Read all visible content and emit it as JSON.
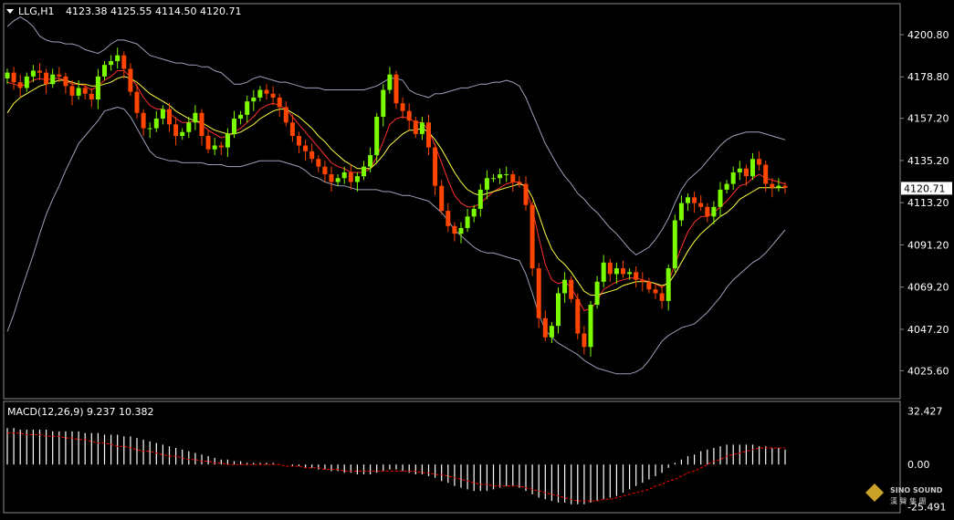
{
  "header": {
    "symbol": "LLG,H1",
    "ohlc": "4123.38 4125.55 4114.50 4120.71"
  },
  "macd_label": "MACD(12,26,9) 9.237 10.382",
  "watermark": {
    "line1": "SINO SOUND",
    "line2": "漢 聲 集 團"
  },
  "colors": {
    "background": "#000000",
    "grid_frame": "#8a8a8a",
    "bull": "#7cfc00",
    "bear": "#ff4500",
    "ma_fast": "#ff3030",
    "ma_slow": "#ffff40",
    "bands": "#9aa0b8",
    "text": "#ffffff",
    "macd_hist": "#ffffff",
    "macd_signal": "#ff0000"
  },
  "chart_data": [
    {
      "type": "candlestick",
      "title": "LLG,H1",
      "ylim": [
        4012,
        4216
      ],
      "y_ticks": [
        4200.8,
        4178.8,
        4157.2,
        4135.2,
        4113.2,
        4091.2,
        4069.2,
        4047.2,
        4025.6
      ],
      "y_tick_labels": [
        "4200.80",
        "4178.80",
        "4157.20",
        "4135.20",
        "4113.20",
        "4091.20",
        "4069.20",
        "4047.20",
        "4025.60"
      ],
      "current_price": 4120.71,
      "current_price_label": "4120.71",
      "closes": [
        4181,
        4176,
        4173,
        4179,
        4182,
        4181,
        4175,
        4180,
        4179,
        4174,
        4169,
        4173,
        4170,
        4167,
        4179,
        4185,
        4187,
        4190,
        4183,
        4171,
        4160,
        4152,
        4152,
        4157,
        4162,
        4154,
        4148,
        4150,
        4155,
        4160,
        4148,
        4141,
        4143,
        4142,
        4149,
        4157,
        4159,
        4166,
        4168,
        4172,
        4170,
        4168,
        4163,
        4155,
        4148,
        4143,
        4140,
        4136,
        4132,
        4128,
        4124,
        4126,
        4129,
        4124,
        4127,
        4132,
        4138,
        4158,
        4172,
        4180,
        4165,
        4161,
        4156,
        4149,
        4155,
        4142,
        4122,
        4109,
        4101,
        4097,
        4100,
        4106,
        4110,
        4120,
        4126,
        4126,
        4128,
        4128,
        4124,
        4123,
        4112,
        4079,
        4053,
        4043,
        4049,
        4066,
        4073,
        4063,
        4045,
        4038,
        4060,
        4072,
        4082,
        4076,
        4079,
        4076,
        4077,
        4073,
        4072,
        4068,
        4066,
        4062,
        4079,
        4104,
        4113,
        4116,
        4113,
        4111,
        4106,
        4111,
        4120,
        4123,
        4129,
        4131,
        4127,
        4136,
        4133,
        4123,
        4121,
        4122,
        4121
      ],
      "series": [
        {
          "name": "MA fast",
          "values": [
            4176,
            4175,
            4174,
            4175,
            4177,
            4178,
            4177,
            4178,
            4178,
            4177,
            4175,
            4175,
            4174,
            4172,
            4174,
            4177,
            4179,
            4182,
            4182,
            4179,
            4174,
            4168,
            4164,
            4162,
            4162,
            4160,
            4157,
            4155,
            4155,
            4156,
            4154,
            4151,
            4149,
            4147,
            4148,
            4150,
            4152,
            4155,
            4158,
            4162,
            4164,
            4165,
            4164,
            4162,
            4158,
            4154,
            4150,
            4146,
            4142,
            4138,
            4134,
            4132,
            4131,
            4129,
            4129,
            4129,
            4131,
            4137,
            4145,
            4154,
            4157,
            4158,
            4157,
            4155,
            4155,
            4151,
            4143,
            4134,
            4125,
            4117,
            4113,
            4111,
            4111,
            4113,
            4116,
            4119,
            4121,
            4123,
            4124,
            4124,
            4121,
            4110,
            4095,
            4081,
            4073,
            4071,
            4072,
            4069,
            4063,
            4057,
            4058,
            4062,
            4068,
            4070,
            4072,
            4073,
            4074,
            4074,
            4073,
            4072,
            4071,
            4069,
            4072,
            4081,
            4090,
            4098,
            4103,
            4106,
            4106,
            4108,
            4111,
            4114,
            4118,
            4122,
            4123,
            4126,
            4128,
            4126,
            4125,
            4124,
            4123
          ]
        },
        {
          "name": "MA slow",
          "values": [
            4160,
            4165,
            4168,
            4170,
            4172,
            4174,
            4175,
            4176,
            4177,
            4177,
            4176,
            4175,
            4175,
            4174,
            4174,
            4175,
            4176,
            4178,
            4179,
            4178,
            4176,
            4173,
            4170,
            4168,
            4166,
            4164,
            4161,
            4159,
            4157,
            4156,
            4155,
            4153,
            4151,
            4150,
            4149,
            4149,
            4150,
            4152,
            4154,
            4157,
            4159,
            4161,
            4162,
            4162,
            4160,
            4158,
            4155,
            4152,
            4148,
            4145,
            4141,
            4138,
            4135,
            4133,
            4131,
            4131,
            4131,
            4134,
            4138,
            4143,
            4146,
            4149,
            4151,
            4151,
            4152,
            4150,
            4146,
            4141,
            4135,
            4129,
            4124,
            4120,
            4118,
            4117,
            4118,
            4119,
            4120,
            4121,
            4122,
            4123,
            4122,
            4116,
            4107,
            4097,
            4089,
            4084,
            4081,
            4077,
            4072,
            4067,
            4065,
            4065,
            4066,
            4067,
            4068,
            4070,
            4071,
            4072,
            4072,
            4072,
            4071,
            4070,
            4071,
            4076,
            4082,
            4088,
            4093,
            4097,
            4100,
            4103,
            4106,
            4108,
            4111,
            4115,
            4117,
            4119,
            4121,
            4121,
            4121,
            4121,
            4121
          ]
        },
        {
          "name": "Upper band",
          "values": [
            4205,
            4208,
            4210,
            4208,
            4205,
            4200,
            4198,
            4197,
            4197,
            4196,
            4196,
            4195,
            4193,
            4192,
            4191,
            4193,
            4196,
            4198,
            4198,
            4197,
            4196,
            4193,
            4190,
            4189,
            4188,
            4187,
            4186,
            4186,
            4185,
            4185,
            4184,
            4184,
            4182,
            4181,
            4178,
            4175,
            4175,
            4176,
            4178,
            4179,
            4178,
            4177,
            4176,
            4176,
            4175,
            4174,
            4173,
            4173,
            4173,
            4172,
            4172,
            4172,
            4172,
            4172,
            4172,
            4172,
            4173,
            4174,
            4176,
            4178,
            4178,
            4177,
            4172,
            4170,
            4169,
            4168,
            4170,
            4170,
            4171,
            4172,
            4173,
            4173,
            4174,
            4175,
            4175,
            4176,
            4176,
            4177,
            4176,
            4174,
            4168,
            4160,
            4152,
            4144,
            4138,
            4132,
            4127,
            4123,
            4118,
            4115,
            4111,
            4108,
            4104,
            4100,
            4097,
            4093,
            4089,
            4086,
            4088,
            4090,
            4094,
            4099,
            4105,
            4113,
            4120,
            4125,
            4128,
            4131,
            4135,
            4139,
            4143,
            4146,
            4148,
            4149,
            4150,
            4150,
            4150,
            4149,
            4148,
            4147,
            4146
          ]
        },
        {
          "name": "Lower band",
          "values": [
            4046,
            4055,
            4066,
            4076,
            4086,
            4097,
            4107,
            4115,
            4122,
            4130,
            4137,
            4144,
            4148,
            4152,
            4156,
            4161,
            4162,
            4163,
            4162,
            4158,
            4152,
            4146,
            4140,
            4137,
            4136,
            4135,
            4135,
            4134,
            4134,
            4134,
            4134,
            4133,
            4133,
            4133,
            4132,
            4132,
            4132,
            4133,
            4134,
            4135,
            4135,
            4135,
            4135,
            4134,
            4133,
            4132,
            4130,
            4127,
            4126,
            4124,
            4123,
            4122,
            4122,
            4121,
            4120,
            4120,
            4120,
            4120,
            4119,
            4119,
            4118,
            4117,
            4117,
            4116,
            4115,
            4114,
            4111,
            4108,
            4104,
            4099,
            4096,
            4093,
            4090,
            4088,
            4087,
            4087,
            4086,
            4085,
            4084,
            4083,
            4076,
            4066,
            4055,
            4047,
            4043,
            4040,
            4038,
            4036,
            4034,
            4031,
            4029,
            4027,
            4026,
            4025,
            4024,
            4024,
            4024,
            4025,
            4027,
            4031,
            4036,
            4041,
            4044,
            4046,
            4048,
            4049,
            4050,
            4053,
            4056,
            4060,
            4064,
            4069,
            4073,
            4076,
            4079,
            4082,
            4084,
            4087,
            4091,
            4095,
            4099
          ]
        }
      ]
    },
    {
      "type": "histogram",
      "title": "MACD(12,26,9) 9.237 10.382",
      "ylim": [
        -28,
        37
      ],
      "y_ticks": [
        32.427,
        0.0,
        -25.491
      ],
      "y_tick_labels": [
        "32.427",
        "0.00",
        "-25.491"
      ],
      "histogram": [
        22,
        22,
        21,
        21,
        21,
        21,
        21,
        20,
        20,
        20,
        20,
        20,
        19,
        19,
        19,
        18,
        18,
        18,
        17,
        17,
        16,
        15,
        14,
        13,
        12,
        11,
        10,
        9,
        8,
        7,
        6,
        5,
        4,
        3,
        3,
        2,
        2,
        1,
        1,
        1,
        1,
        1,
        0,
        0,
        -1,
        -1,
        -2,
        -2,
        -3,
        -3,
        -4,
        -4,
        -5,
        -5,
        -6,
        -6,
        -6,
        -5,
        -4,
        -3,
        -3,
        -4,
        -5,
        -6,
        -6,
        -7,
        -8,
        -10,
        -11,
        -13,
        -14,
        -15,
        -16,
        -16,
        -16,
        -15,
        -14,
        -13,
        -13,
        -14,
        -16,
        -18,
        -20,
        -21,
        -22,
        -23,
        -23,
        -24,
        -24,
        -24,
        -23,
        -22,
        -21,
        -20,
        -19,
        -17,
        -15,
        -13,
        -11,
        -9,
        -7,
        -5,
        -2,
        1,
        3,
        5,
        6,
        8,
        9,
        10,
        11,
        12,
        12,
        12,
        12,
        12,
        11,
        11,
        10,
        10,
        9
      ],
      "signal": [
        19,
        19,
        19,
        18,
        18,
        18,
        17,
        17,
        17,
        16,
        16,
        15,
        15,
        14,
        13,
        13,
        12,
        11,
        11,
        10,
        9,
        8,
        8,
        7,
        6,
        5,
        5,
        4,
        3,
        3,
        2,
        2,
        1,
        1,
        0,
        0,
        0,
        0,
        0,
        0,
        0,
        0,
        0,
        -1,
        -1,
        -1,
        -2,
        -2,
        -2,
        -3,
        -3,
        -3,
        -4,
        -4,
        -4,
        -4,
        -4,
        -4,
        -4,
        -4,
        -4,
        -4,
        -4,
        -4,
        -5,
        -5,
        -6,
        -6,
        -7,
        -8,
        -9,
        -10,
        -11,
        -12,
        -12,
        -13,
        -13,
        -13,
        -13,
        -13,
        -14,
        -15,
        -16,
        -17,
        -18,
        -19,
        -20,
        -21,
        -22,
        -22,
        -22,
        -22,
        -21,
        -21,
        -20,
        -19,
        -18,
        -17,
        -16,
        -15,
        -13,
        -12,
        -10,
        -9,
        -7,
        -5,
        -4,
        -2,
        0,
        2,
        3,
        5,
        6,
        7,
        8,
        9,
        10,
        10,
        10,
        10,
        10
      ]
    }
  ]
}
